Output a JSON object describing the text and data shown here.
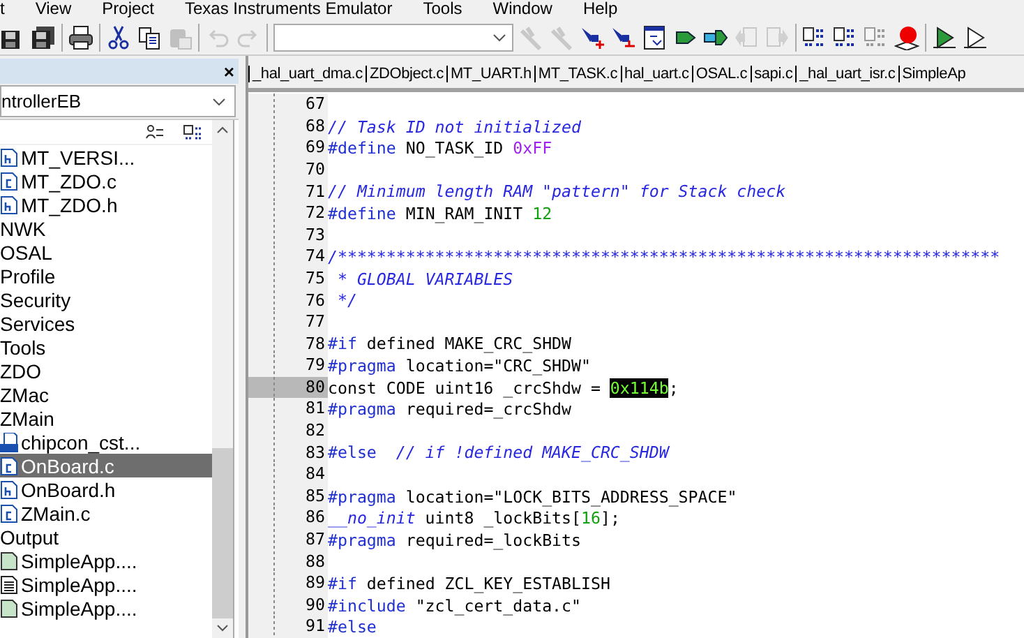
{
  "menu": [
    {
      "label": "t"
    },
    {
      "label": "View"
    },
    {
      "label": "Project"
    },
    {
      "label": "Texas Instruments Emulator"
    },
    {
      "label": "Tools"
    },
    {
      "label": "Window"
    },
    {
      "label": "Help"
    }
  ],
  "toolbar": [
    {
      "kind": "save",
      "disabled": false
    },
    {
      "kind": "saveall",
      "disabled": false
    },
    {
      "kind": "sep"
    },
    {
      "kind": "print",
      "disabled": false
    },
    {
      "kind": "sep"
    },
    {
      "kind": "cut",
      "disabled": false
    },
    {
      "kind": "copy",
      "disabled": false
    },
    {
      "kind": "paste",
      "disabled": true
    },
    {
      "kind": "sep"
    },
    {
      "kind": "undo",
      "disabled": true
    },
    {
      "kind": "redo",
      "disabled": true
    },
    {
      "kind": "sep"
    },
    {
      "kind": "combo"
    },
    {
      "kind": "check",
      "disabled": true
    },
    {
      "kind": "check",
      "disabled": true
    },
    {
      "kind": "pinadd",
      "disabled": false
    },
    {
      "kind": "pinremove",
      "disabled": false
    },
    {
      "kind": "window",
      "disabled": false
    },
    {
      "kind": "next",
      "disabled": false
    },
    {
      "kind": "nextall",
      "disabled": false
    },
    {
      "kind": "pageleft",
      "disabled": true
    },
    {
      "kind": "pageright",
      "disabled": true
    },
    {
      "kind": "sep"
    },
    {
      "kind": "binary",
      "disabled": false
    },
    {
      "kind": "binary",
      "disabled": false
    },
    {
      "kind": "binaryx",
      "disabled": true
    },
    {
      "kind": "stop",
      "disabled": false
    },
    {
      "kind": "sep"
    },
    {
      "kind": "play",
      "disabled": false
    },
    {
      "kind": "playout",
      "disabled": false
    }
  ],
  "workspace": {
    "close": "×",
    "config": "ntrollerEB",
    "items": [
      {
        "label": "MT_VERSI...",
        "kind": "h",
        "selected": false
      },
      {
        "label": "MT_ZDO.c",
        "kind": "c",
        "selected": false
      },
      {
        "label": "MT_ZDO.h",
        "kind": "h",
        "selected": false
      },
      {
        "label": "NWK",
        "kind": "group",
        "selected": false
      },
      {
        "label": "OSAL",
        "kind": "group",
        "selected": false
      },
      {
        "label": "Profile",
        "kind": "group",
        "selected": false
      },
      {
        "label": "Security",
        "kind": "group",
        "selected": false
      },
      {
        "label": "Services",
        "kind": "group",
        "selected": false
      },
      {
        "label": "Tools",
        "kind": "group",
        "selected": false
      },
      {
        "label": "ZDO",
        "kind": "group",
        "selected": false
      },
      {
        "label": "ZMac",
        "kind": "group",
        "selected": false
      },
      {
        "label": "ZMain",
        "kind": "group",
        "selected": false
      },
      {
        "label": "chipcon_cst...",
        "kind": "asm",
        "selected": false
      },
      {
        "label": "OnBoard.c",
        "kind": "c",
        "selected": true
      },
      {
        "label": "OnBoard.h",
        "kind": "h",
        "selected": false
      },
      {
        "label": "ZMain.c",
        "kind": "c",
        "selected": false
      },
      {
        "label": "Output",
        "kind": "group",
        "selected": false
      },
      {
        "label": "SimpleApp....",
        "kind": "out",
        "selected": false
      },
      {
        "label": "SimpleApp....",
        "kind": "text",
        "selected": false
      },
      {
        "label": "SimpleApp....",
        "kind": "out",
        "selected": false
      }
    ]
  },
  "tabs": [
    {
      "label": "_hal_uart_dma.c"
    },
    {
      "label": "ZDObject.c"
    },
    {
      "label": "MT_UART.h"
    },
    {
      "label": "MT_TASK.c"
    },
    {
      "label": "hal_uart.c"
    },
    {
      "label": "OSAL.c"
    },
    {
      "label": "sapi.c"
    },
    {
      "label": "_hal_uart_isr.c"
    },
    {
      "label": "SimpleAp"
    }
  ],
  "editor": {
    "lines": [
      {
        "number": "67",
        "current": false
      },
      {
        "number": "68",
        "current": false,
        "segments": [
          {
            "kind": "comment",
            "text": "// Task ID not initialized"
          }
        ]
      },
      {
        "number": "69",
        "current": false,
        "segments": [
          {
            "kind": "pp",
            "text": "#define"
          },
          {
            "kind": "text",
            "text": " NO_TASK_ID "
          },
          {
            "kind": "hex",
            "text": "0xFF"
          }
        ]
      },
      {
        "number": "70",
        "current": false
      },
      {
        "number": "71",
        "current": false,
        "segments": [
          {
            "kind": "comment",
            "text": "// Minimum length RAM \"pattern\" for Stack check"
          }
        ]
      },
      {
        "number": "72",
        "current": false,
        "segments": [
          {
            "kind": "pp",
            "text": "#define"
          },
          {
            "kind": "text",
            "text": " MIN_RAM_INIT "
          },
          {
            "kind": "num",
            "text": "12"
          }
        ]
      },
      {
        "number": "73",
        "current": false
      },
      {
        "number": "74",
        "current": false,
        "segments": [
          {
            "kind": "comment",
            "text": "/********************************************************************"
          }
        ]
      },
      {
        "number": "75",
        "current": false,
        "segments": [
          {
            "kind": "comment",
            "text": " * GLOBAL VARIABLES"
          }
        ]
      },
      {
        "number": "76",
        "current": false,
        "segments": [
          {
            "kind": "comment",
            "text": " */"
          }
        ]
      },
      {
        "number": "77",
        "current": false
      },
      {
        "number": "78",
        "current": false,
        "segments": [
          {
            "kind": "pp",
            "text": "#if"
          },
          {
            "kind": "text",
            "text": " defined MAKE_CRC_SHDW"
          }
        ]
      },
      {
        "number": "79",
        "current": false,
        "segments": [
          {
            "kind": "pp",
            "text": "#pragma"
          },
          {
            "kind": "text",
            "text": " location=\"CRC_SHDW\""
          }
        ]
      },
      {
        "number": "80",
        "current": true,
        "segments": [
          {
            "kind": "text",
            "text": "const CODE uint16 _crcShdw = "
          },
          {
            "kind": "match",
            "text": "0x114b"
          },
          {
            "kind": "text",
            "text": ";"
          }
        ]
      },
      {
        "number": "81",
        "current": false,
        "segments": [
          {
            "kind": "pp",
            "text": "#pragma"
          },
          {
            "kind": "text",
            "text": " required=_crcShdw"
          }
        ]
      },
      {
        "number": "82",
        "current": false
      },
      {
        "number": "83",
        "current": false,
        "segments": [
          {
            "kind": "pp",
            "text": "#else"
          },
          {
            "kind": "comment",
            "text": "  // if !defined MAKE_CRC_SHDW"
          }
        ]
      },
      {
        "number": "84",
        "current": false
      },
      {
        "number": "85",
        "current": false,
        "segments": [
          {
            "kind": "pp",
            "text": "#pragma"
          },
          {
            "kind": "text",
            "text": " location=\"LOCK_BITS_ADDRESS_SPACE\""
          }
        ]
      },
      {
        "number": "86",
        "current": false,
        "segments": [
          {
            "kind": "keyword",
            "text": "__no_init"
          },
          {
            "kind": "text",
            "text": " uint8 _lockBits["
          },
          {
            "kind": "num",
            "text": "16"
          },
          {
            "kind": "text",
            "text": "];"
          }
        ]
      },
      {
        "number": "87",
        "current": false,
        "segments": [
          {
            "kind": "pp",
            "text": "#pragma"
          },
          {
            "kind": "text",
            "text": " required=_lockBits"
          }
        ]
      },
      {
        "number": "88",
        "current": false
      },
      {
        "number": "89",
        "current": false,
        "segments": [
          {
            "kind": "pp",
            "text": "#if"
          },
          {
            "kind": "text",
            "text": " defined ZCL_KEY_ESTABLISH"
          }
        ]
      },
      {
        "number": "90",
        "current": false,
        "segments": [
          {
            "kind": "pp",
            "text": "#include"
          },
          {
            "kind": "text",
            "text": " \"zcl_cert_data.c\""
          }
        ]
      },
      {
        "number": "91",
        "current": false,
        "segments": [
          {
            "kind": "pp",
            "text": "#else"
          }
        ]
      }
    ]
  }
}
